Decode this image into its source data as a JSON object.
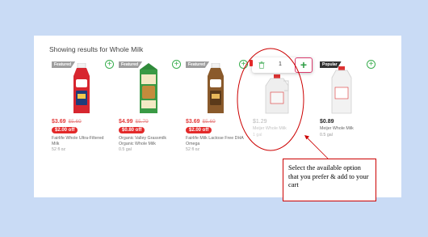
{
  "results_heading": "Showing results for Whole Milk",
  "products": [
    {
      "badge": "Featured",
      "price": "$3.69",
      "old_price": "$5.69",
      "discount": "$2.00 off",
      "name": "Fairlife Whole Ultra-Filtered Milk",
      "size": "52 fl oz"
    },
    {
      "badge": "Featured",
      "price": "$4.99",
      "old_price": "$5.79",
      "discount": "$0.80 off",
      "name": "Organic Valley Grassmilk Organic Whole Milk",
      "size": "0.5 gal"
    },
    {
      "badge": "Featured",
      "price": "$3.69",
      "old_price": "$5.69",
      "discount": "$2.00 off",
      "name": "Fairlife Milk Lactose Free DHA Omega",
      "size": "52 fl oz"
    },
    {
      "badge": "",
      "price": "$1.29",
      "old_price": "",
      "discount": "",
      "name": "Meijer Whole Milk",
      "size": "1 gal"
    },
    {
      "badge": "Popular",
      "price": "$0.89",
      "old_price": "",
      "discount": "",
      "name": "Meijer Whole Milk",
      "size": "0.5 gal"
    }
  ],
  "stepper": {
    "quantity": "1"
  },
  "callout": {
    "text": "Select the available option that you prefer & add to your cart"
  },
  "colors": {
    "accent_green": "#3aae4f",
    "sale_red": "#e33b3b",
    "annotation_red": "#cc0000",
    "background": "#c9dbf5"
  }
}
